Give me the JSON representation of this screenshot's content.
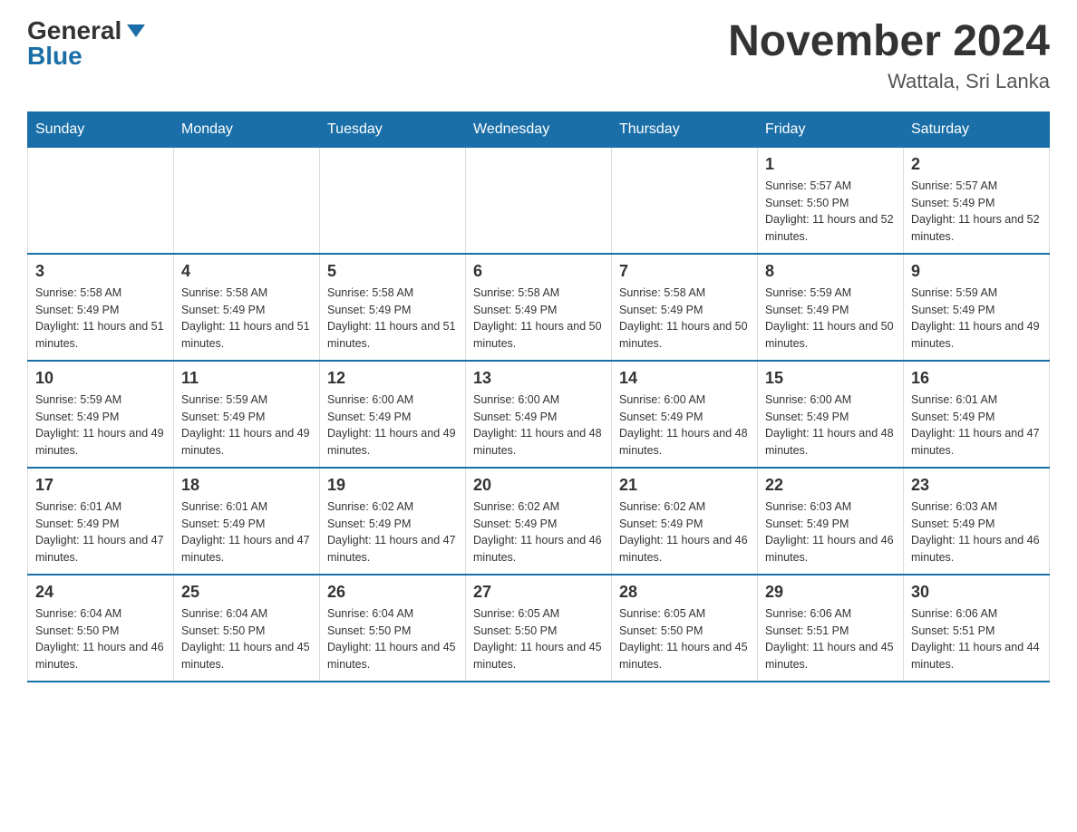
{
  "header": {
    "logo_general": "General",
    "logo_blue": "Blue",
    "month_year": "November 2024",
    "location": "Wattala, Sri Lanka"
  },
  "days_of_week": [
    "Sunday",
    "Monday",
    "Tuesday",
    "Wednesday",
    "Thursday",
    "Friday",
    "Saturday"
  ],
  "weeks": [
    [
      {
        "day": "",
        "sunrise": "",
        "sunset": "",
        "daylight": ""
      },
      {
        "day": "",
        "sunrise": "",
        "sunset": "",
        "daylight": ""
      },
      {
        "day": "",
        "sunrise": "",
        "sunset": "",
        "daylight": ""
      },
      {
        "day": "",
        "sunrise": "",
        "sunset": "",
        "daylight": ""
      },
      {
        "day": "",
        "sunrise": "",
        "sunset": "",
        "daylight": ""
      },
      {
        "day": "1",
        "sunrise": "Sunrise: 5:57 AM",
        "sunset": "Sunset: 5:50 PM",
        "daylight": "Daylight: 11 hours and 52 minutes."
      },
      {
        "day": "2",
        "sunrise": "Sunrise: 5:57 AM",
        "sunset": "Sunset: 5:49 PM",
        "daylight": "Daylight: 11 hours and 52 minutes."
      }
    ],
    [
      {
        "day": "3",
        "sunrise": "Sunrise: 5:58 AM",
        "sunset": "Sunset: 5:49 PM",
        "daylight": "Daylight: 11 hours and 51 minutes."
      },
      {
        "day": "4",
        "sunrise": "Sunrise: 5:58 AM",
        "sunset": "Sunset: 5:49 PM",
        "daylight": "Daylight: 11 hours and 51 minutes."
      },
      {
        "day": "5",
        "sunrise": "Sunrise: 5:58 AM",
        "sunset": "Sunset: 5:49 PM",
        "daylight": "Daylight: 11 hours and 51 minutes."
      },
      {
        "day": "6",
        "sunrise": "Sunrise: 5:58 AM",
        "sunset": "Sunset: 5:49 PM",
        "daylight": "Daylight: 11 hours and 50 minutes."
      },
      {
        "day": "7",
        "sunrise": "Sunrise: 5:58 AM",
        "sunset": "Sunset: 5:49 PM",
        "daylight": "Daylight: 11 hours and 50 minutes."
      },
      {
        "day": "8",
        "sunrise": "Sunrise: 5:59 AM",
        "sunset": "Sunset: 5:49 PM",
        "daylight": "Daylight: 11 hours and 50 minutes."
      },
      {
        "day": "9",
        "sunrise": "Sunrise: 5:59 AM",
        "sunset": "Sunset: 5:49 PM",
        "daylight": "Daylight: 11 hours and 49 minutes."
      }
    ],
    [
      {
        "day": "10",
        "sunrise": "Sunrise: 5:59 AM",
        "sunset": "Sunset: 5:49 PM",
        "daylight": "Daylight: 11 hours and 49 minutes."
      },
      {
        "day": "11",
        "sunrise": "Sunrise: 5:59 AM",
        "sunset": "Sunset: 5:49 PM",
        "daylight": "Daylight: 11 hours and 49 minutes."
      },
      {
        "day": "12",
        "sunrise": "Sunrise: 6:00 AM",
        "sunset": "Sunset: 5:49 PM",
        "daylight": "Daylight: 11 hours and 49 minutes."
      },
      {
        "day": "13",
        "sunrise": "Sunrise: 6:00 AM",
        "sunset": "Sunset: 5:49 PM",
        "daylight": "Daylight: 11 hours and 48 minutes."
      },
      {
        "day": "14",
        "sunrise": "Sunrise: 6:00 AM",
        "sunset": "Sunset: 5:49 PM",
        "daylight": "Daylight: 11 hours and 48 minutes."
      },
      {
        "day": "15",
        "sunrise": "Sunrise: 6:00 AM",
        "sunset": "Sunset: 5:49 PM",
        "daylight": "Daylight: 11 hours and 48 minutes."
      },
      {
        "day": "16",
        "sunrise": "Sunrise: 6:01 AM",
        "sunset": "Sunset: 5:49 PM",
        "daylight": "Daylight: 11 hours and 47 minutes."
      }
    ],
    [
      {
        "day": "17",
        "sunrise": "Sunrise: 6:01 AM",
        "sunset": "Sunset: 5:49 PM",
        "daylight": "Daylight: 11 hours and 47 minutes."
      },
      {
        "day": "18",
        "sunrise": "Sunrise: 6:01 AM",
        "sunset": "Sunset: 5:49 PM",
        "daylight": "Daylight: 11 hours and 47 minutes."
      },
      {
        "day": "19",
        "sunrise": "Sunrise: 6:02 AM",
        "sunset": "Sunset: 5:49 PM",
        "daylight": "Daylight: 11 hours and 47 minutes."
      },
      {
        "day": "20",
        "sunrise": "Sunrise: 6:02 AM",
        "sunset": "Sunset: 5:49 PM",
        "daylight": "Daylight: 11 hours and 46 minutes."
      },
      {
        "day": "21",
        "sunrise": "Sunrise: 6:02 AM",
        "sunset": "Sunset: 5:49 PM",
        "daylight": "Daylight: 11 hours and 46 minutes."
      },
      {
        "day": "22",
        "sunrise": "Sunrise: 6:03 AM",
        "sunset": "Sunset: 5:49 PM",
        "daylight": "Daylight: 11 hours and 46 minutes."
      },
      {
        "day": "23",
        "sunrise": "Sunrise: 6:03 AM",
        "sunset": "Sunset: 5:49 PM",
        "daylight": "Daylight: 11 hours and 46 minutes."
      }
    ],
    [
      {
        "day": "24",
        "sunrise": "Sunrise: 6:04 AM",
        "sunset": "Sunset: 5:50 PM",
        "daylight": "Daylight: 11 hours and 46 minutes."
      },
      {
        "day": "25",
        "sunrise": "Sunrise: 6:04 AM",
        "sunset": "Sunset: 5:50 PM",
        "daylight": "Daylight: 11 hours and 45 minutes."
      },
      {
        "day": "26",
        "sunrise": "Sunrise: 6:04 AM",
        "sunset": "Sunset: 5:50 PM",
        "daylight": "Daylight: 11 hours and 45 minutes."
      },
      {
        "day": "27",
        "sunrise": "Sunrise: 6:05 AM",
        "sunset": "Sunset: 5:50 PM",
        "daylight": "Daylight: 11 hours and 45 minutes."
      },
      {
        "day": "28",
        "sunrise": "Sunrise: 6:05 AM",
        "sunset": "Sunset: 5:50 PM",
        "daylight": "Daylight: 11 hours and 45 minutes."
      },
      {
        "day": "29",
        "sunrise": "Sunrise: 6:06 AM",
        "sunset": "Sunset: 5:51 PM",
        "daylight": "Daylight: 11 hours and 45 minutes."
      },
      {
        "day": "30",
        "sunrise": "Sunrise: 6:06 AM",
        "sunset": "Sunset: 5:51 PM",
        "daylight": "Daylight: 11 hours and 44 minutes."
      }
    ]
  ]
}
